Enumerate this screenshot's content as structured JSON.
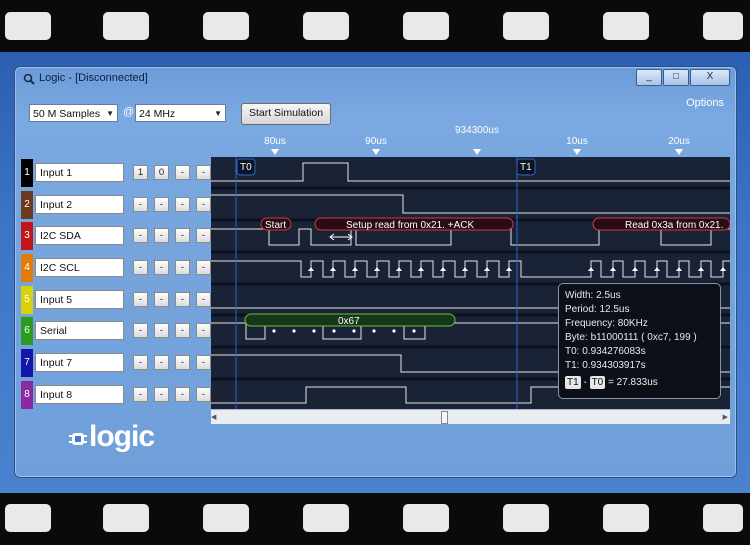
{
  "window": {
    "title": "Logic - [Disconnected]",
    "options_label": "Options",
    "min_label": "_",
    "max_label": "□",
    "close_label": "X"
  },
  "toolbar": {
    "samples_value": "50 M Samples",
    "at_label": "@",
    "rate_value": "24 MHz",
    "start_label": "Start Simulation"
  },
  "ruler": {
    "center_time": "934300us",
    "left_labels": [
      "80us",
      "90us"
    ],
    "right_labels": [
      "10us",
      "20us"
    ]
  },
  "markers": {
    "t0": "T0",
    "t1": "T1"
  },
  "channels": [
    {
      "number": "1",
      "name": "Input 1",
      "color": "#000000",
      "buttons": [
        "1",
        "0",
        "-",
        "-"
      ]
    },
    {
      "number": "2",
      "name": "Input 2",
      "color": "#6b3a1f",
      "buttons": [
        "-",
        "-",
        "-",
        "-"
      ]
    },
    {
      "number": "3",
      "name": "I2C SDA",
      "color": "#c0161b",
      "buttons": [
        "-",
        "-",
        "-",
        "-"
      ]
    },
    {
      "number": "4",
      "name": "I2C SCL",
      "color": "#e07b0c",
      "buttons": [
        "-",
        "-",
        "-",
        "-"
      ]
    },
    {
      "number": "5",
      "name": "Input 5",
      "color": "#d7d20c",
      "buttons": [
        "-",
        "-",
        "-",
        "-"
      ]
    },
    {
      "number": "6",
      "name": "Serial",
      "color": "#2d9b20",
      "buttons": [
        "-",
        "-",
        "-",
        "-"
      ]
    },
    {
      "number": "7",
      "name": "Input 7",
      "color": "#1416a8",
      "buttons": [
        "-",
        "-",
        "-",
        "-"
      ]
    },
    {
      "number": "8",
      "name": "Input 8",
      "color": "#8a2aa3",
      "buttons": [
        "-",
        "-",
        "-",
        "-"
      ]
    }
  ],
  "annotations": {
    "start": "Start",
    "setup": "Setup read from 0x21. +ACK",
    "read": "Read 0x3a from 0x21.",
    "serial_byte": "0x67"
  },
  "tooltip": {
    "width": "Width: 2.5us",
    "period": "Period: 12.5us",
    "frequency": "Frequency: 80KHz",
    "byte": "Byte: b11000111 ( 0xc7, 199 )",
    "t0": "T0: 0.934276083s",
    "t1": "T1: 0.934303917s",
    "t1_tag": "T1",
    "minus": "-",
    "t0_tag": "T0",
    "delta": "= 27.833us"
  },
  "brand": {
    "logo_text": "logic"
  }
}
